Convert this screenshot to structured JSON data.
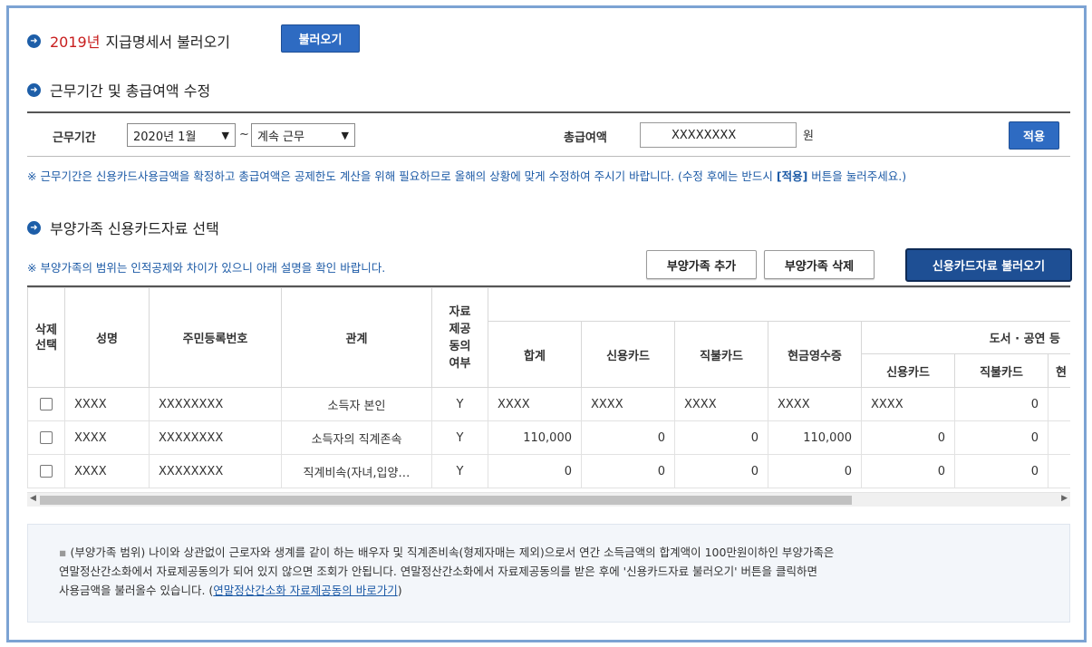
{
  "section1": {
    "year": "2019년",
    "title_rest": "지급명세서 불러오기",
    "load_button": "불러오기"
  },
  "section2": {
    "title": "근무기간 및 총급여액 수정",
    "period_label": "근무기간",
    "start_value": "2020년 1월",
    "tilde": "~",
    "end_value": "계속 근무",
    "salary_label": "총급여액",
    "salary_value": "XXXXXXXX",
    "unit": "원",
    "apply_button": "적용",
    "note_pre": "※ 근무기간은 신용카드사용금액을 확정하고 총급여액은 공제한도 계산을 위해 필요하므로 올해의 상황에 맞게 수정하여 주시기 바랍니다. (수정 후에는 반드시",
    "note_bold": "[적용]",
    "note_post": "버튼을 눌러주세요.)"
  },
  "section3": {
    "title": "부양가족 신용카드자료 선택",
    "note": "※ 부양가족의 범위는 인적공제와 차이가 있으니 아래 설명을 확인 바랍니다.",
    "add_button": "부양가족 추가",
    "delete_button": "부양가족 삭제",
    "load_card_button": "신용카드자료 불러오기"
  },
  "table": {
    "headers": {
      "delete_select": "삭제선택",
      "name": "성명",
      "rrn": "주민등록번호",
      "relation": "관계",
      "consent": "자료제공동의여부",
      "total": "합계",
      "credit": "신용카드",
      "debit": "직불카드",
      "cash_receipt": "현금영수증",
      "books_group": "도서 · 공연 등",
      "books_credit": "신용카드",
      "books_debit": "직불카드",
      "books_cash": "현"
    },
    "rows": [
      {
        "name": "XXXX",
        "rrn": "XXXXXXXX",
        "relation": "소득자 본인",
        "consent": "Y",
        "total": "XXXX",
        "credit": "XXXX",
        "debit": "XXXX",
        "cash": "XXXX",
        "b_credit": "XXXX",
        "b_debit": "0"
      },
      {
        "name": "XXXX",
        "rrn": "XXXXXXXX",
        "relation": "소득자의 직계존속",
        "consent": "Y",
        "total": "110,000",
        "credit": "0",
        "debit": "0",
        "cash": "110,000",
        "b_credit": "0",
        "b_debit": "0"
      },
      {
        "name": "XXXX",
        "rrn": "XXXXXXXX",
        "relation": "직계비속(자녀,입양…",
        "consent": "Y",
        "total": "0",
        "credit": "0",
        "debit": "0",
        "cash": "0",
        "b_credit": "0",
        "b_debit": "0"
      }
    ]
  },
  "info": {
    "line1": "(부양가족 범위) 나이와 상관없이 근로자와 생계를 같이 하는 배우자 및 직계존비속(형제자매는 제외)으로서 연간 소득금액의 합계액이 100만원이하인 부양가족은",
    "line2": "연말정산간소화에서 자료제공동의가 되어 있지 않으면 조회가 안됩니다. 연말정산간소화에서 자료제공동의를 받은 후에 '신용카드자료 불러오기' 버튼을 클릭하면",
    "line3_pre": "사용금액을 불러올수 있습니다. (",
    "link": "연말정산간소화 자료제공동의 바로가기",
    "line3_post": ")"
  }
}
